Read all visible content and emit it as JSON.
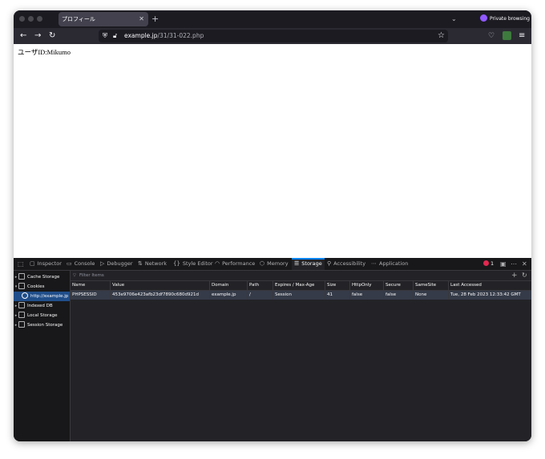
{
  "browser": {
    "tab_title": "プロフィール",
    "tab_close": "✕",
    "new_tab": "+",
    "tab_list": "⌄",
    "private_label": "Private browsing"
  },
  "navbar": {
    "back": "←",
    "forward": "→",
    "reload": "↻",
    "url_domain": "example.jp",
    "url_path": "/31/31-022.php",
    "bookmark": "☆",
    "menu": "≡"
  },
  "page": {
    "content_text": "ユーザID:Mikumo"
  },
  "devtools": {
    "tabs": [
      {
        "icon": "▢",
        "label": "Inspector"
      },
      {
        "icon": "▭",
        "label": "Console"
      },
      {
        "icon": "▷",
        "label": "Debugger"
      },
      {
        "icon": "⇅",
        "label": "Network"
      },
      {
        "icon": "{}",
        "label": "Style Editor"
      },
      {
        "icon": "◠",
        "label": "Performance"
      },
      {
        "icon": "⬡",
        "label": "Memory"
      },
      {
        "icon": "☰",
        "label": "Storage"
      },
      {
        "icon": "⚲",
        "label": "Accessibility"
      },
      {
        "icon": "⋯",
        "label": "Application"
      }
    ],
    "error_count": "1",
    "toolbar_more": "⋯",
    "toolbar_close": "✕",
    "sidebar": [
      {
        "twisty": "▸",
        "label": "Cache Storage"
      },
      {
        "twisty": "▾",
        "label": "Cookies"
      },
      {
        "twisty": "",
        "label": "http://example.jp"
      },
      {
        "twisty": "▸",
        "label": "Indexed DB"
      },
      {
        "twisty": "▸",
        "label": "Local Storage"
      },
      {
        "twisty": "▸",
        "label": "Session Storage"
      }
    ],
    "filter_placeholder": "Filter Items",
    "add": "+",
    "refresh": "↻",
    "columns": [
      "Name",
      "Value",
      "Domain",
      "Path",
      "Expires / Max-Age",
      "Size",
      "HttpOnly",
      "Secure",
      "SameSite",
      "Last Accessed"
    ],
    "rows": [
      [
        "PHPSESSID",
        "453e9706e423afb23df7890c680d921d",
        "example.jp",
        "/",
        "Session",
        "41",
        "false",
        "false",
        "None",
        "Tue, 28 Feb 2023 12:33:42 GMT"
      ]
    ]
  }
}
